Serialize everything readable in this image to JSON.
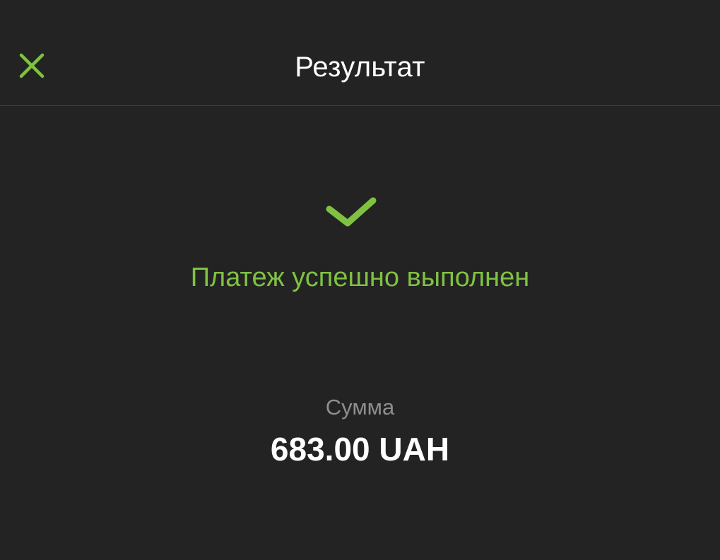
{
  "header": {
    "title": "Результат",
    "close_icon": "close-icon"
  },
  "status": {
    "icon": "checkmark-icon",
    "text": "Платеж успешно выполнен"
  },
  "amount": {
    "label": "Сумма",
    "value": "683.00 UAH"
  },
  "colors": {
    "accent": "#7fc242",
    "background": "#232323",
    "muted": "#8e8e8e",
    "text": "#ffffff"
  }
}
